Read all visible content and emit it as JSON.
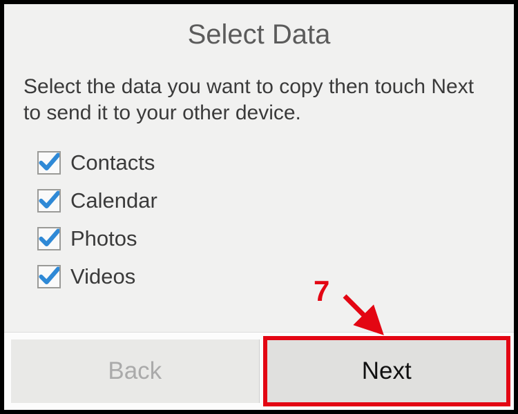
{
  "title": "Select Data",
  "instruction": "Select the data you want to copy then touch Next to send it to your other device.",
  "options": {
    "contacts": {
      "label": "Contacts",
      "checked": true
    },
    "calendar": {
      "label": "Calendar",
      "checked": true
    },
    "photos": {
      "label": "Photos",
      "checked": true
    },
    "videos": {
      "label": "Videos",
      "checked": true
    }
  },
  "buttons": {
    "back": "Back",
    "next": "Next"
  },
  "annotation": {
    "step": "7"
  }
}
